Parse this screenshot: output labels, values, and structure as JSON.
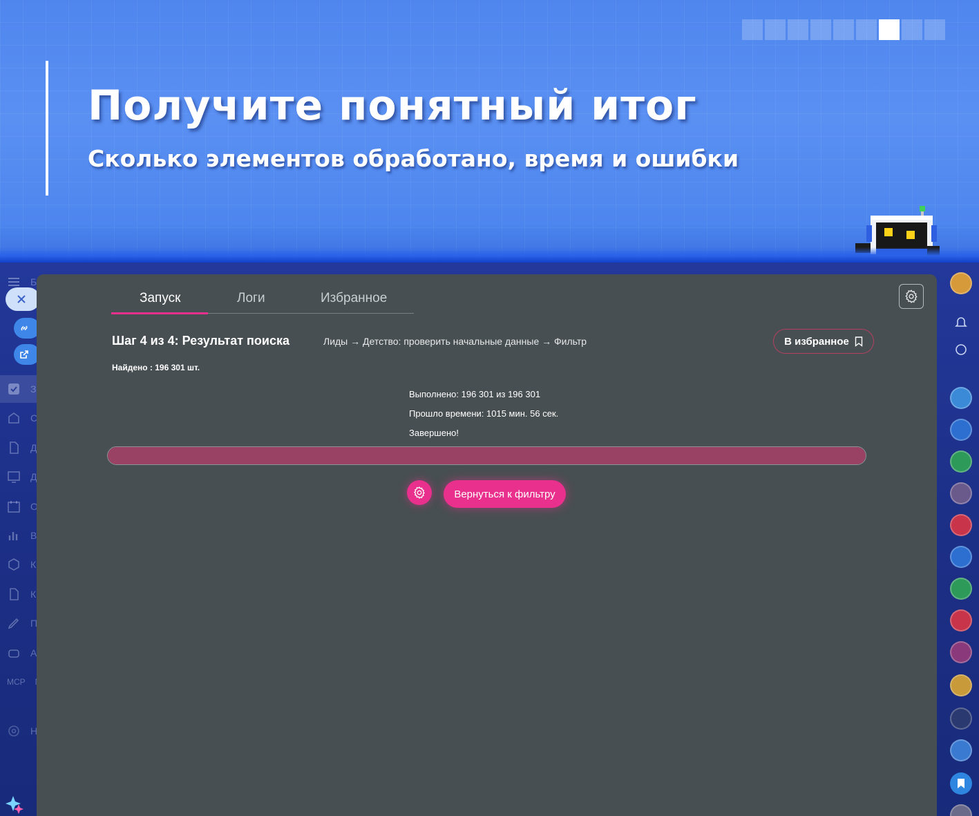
{
  "banner": {
    "title": "Получите понятный итог",
    "subtitle": "Сколько элементов обработано, время и ошибки",
    "page_count": 9,
    "active_page": 7
  },
  "tabs": [
    {
      "label": "Запуск",
      "active": true
    },
    {
      "label": "Логи",
      "active": false
    },
    {
      "label": "Избранное",
      "active": false
    }
  ],
  "step": {
    "title": "Шаг 4 из 4: Результат поиска",
    "breadcrumb": "Лиды → Детство: проверить начальные данные → Фильтр",
    "favorite_label": "В избранное",
    "found": "Найдено : 196 301 шт."
  },
  "result": {
    "done": "Выполнено: 196 301 из 196 301",
    "elapsed": "Прошло времени: 1015 мин. 56 сек.",
    "status": "Завершено!",
    "progress": 1.0
  },
  "actions": {
    "return_label": "Вернуться к фильтру"
  },
  "left_sidebar_partial_labels": [
    "Б",
    "З",
    "С",
    "Д",
    "Д",
    "О",
    "В",
    "К",
    "К",
    "П",
    "А",
    "М",
    "Н"
  ],
  "left_sidebar_mcp_label": "MCP",
  "colors": {
    "accent": "#e8308c",
    "panel": "#484f52",
    "progress_fill": "#9a4264",
    "banner_blue": "#4f86ee"
  }
}
